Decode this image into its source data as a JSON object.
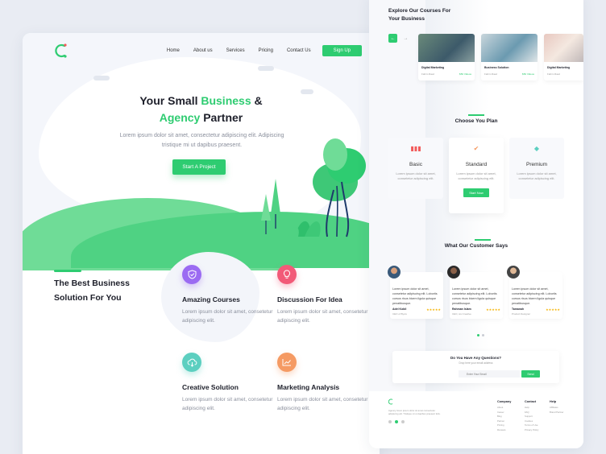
{
  "nav": {
    "items": [
      "Home",
      "About us",
      "Services",
      "Pricing",
      "Contact Us"
    ],
    "signup_label": "Sign Up"
  },
  "hero": {
    "title_1": "Your Small ",
    "title_green_1": "Business",
    "title_2": " &",
    "title_green_2": "Agency",
    "title_3": " Partner",
    "subtitle": "Lorem ipsum dolor sit amet, consectetur adipiscing elit. Adipiscing tristique mi ut dapibus praesent.",
    "cta_label": "Start A Project"
  },
  "best": {
    "title": "The Best Business Solution For You"
  },
  "features": [
    {
      "title": "Amazing Courses",
      "desc": "Lorem ipsum dolor sit amet, consetetur adipiscing elit.",
      "icon": "shield-check-icon",
      "color": "#9b6bf2"
    },
    {
      "title": "Discussion For Idea",
      "desc": "Lorem ipsum dolor sit amet, consetetur adipiscing elit.",
      "icon": "lightbulb-icon",
      "color": "#f25a78"
    },
    {
      "title": "Creative Solution",
      "desc": "Lorem ipsum dolor sit amet, consetetur adipiscing elit.",
      "icon": "cloud-icon",
      "color": "#5ccfc0"
    },
    {
      "title": "Marketing Analysis",
      "desc": "Lorem ipsum dolor sit amet, consetetur adipiscing elit.",
      "icon": "chart-icon",
      "color": "#f59a63"
    }
  ],
  "explore": {
    "title": "Explore Our Courses For Your Business",
    "courses": [
      {
        "name": "Digital Marketing",
        "author": "Fahim Raaz",
        "price": "$50 Videos"
      },
      {
        "name": "Business Solution",
        "author": "Fahim Raaz",
        "price": "$50 Videos"
      },
      {
        "name": "Digital Marketing",
        "author": "Fahim Raaz",
        "price": ""
      }
    ]
  },
  "plans": {
    "title": "Choose You Plan",
    "items": [
      {
        "name": "Basic",
        "desc": "Lorem ipsum dolor sit amet, consetetur adipiscing elit.",
        "icon": "bar-chart-icon",
        "color": "#f25a5a"
      },
      {
        "name": "Standard",
        "desc": "Lorem ipsum dolor sit amet, consetetur adipiscing elit.",
        "icon": "check-circle-icon",
        "color": "#f59a63",
        "button": "Start Now"
      },
      {
        "name": "Premium",
        "desc": "Lorem ipsum dolor sit amet, consetetur adipiscing elit.",
        "icon": "diamond-icon",
        "color": "#5ccfc0"
      }
    ]
  },
  "testimonials": {
    "title": "What Our Customer Says",
    "items": [
      {
        "quote": "Lorem ipsum dolor sit amet, consetetur adipiscing elit. Lobortis cursus risus bicem ligula quisque penatibusque.",
        "name": "Adel Kobil",
        "role": "CEO of Byxis",
        "stars": "★★★★★"
      },
      {
        "quote": "Lorem ipsum dolor sit amet, consetetur adipiscing elit. Lobortis cursus risus bicem ligula quisque penatibusque.",
        "name": "Rahman Islam",
        "role": "CEO, sis Creative",
        "stars": "★★★★★"
      },
      {
        "quote": "Lorem ipsum dolor sit amet, consetetur adipiscing elit. Lobortis cursus risus bicem ligula quisque penatibusque.",
        "name": "Tamanah",
        "role": "Product Designer",
        "stars": "★★★★★"
      }
    ]
  },
  "question": {
    "title": "Do You Have Any Questions?",
    "sub": "Drop here your email address",
    "placeholder": "Enter Your Email",
    "button": "Send"
  },
  "footer": {
    "about": "Agency lorem ipsum dolor sit amet consectetur adipiscing elit. Tristique mi ut dapibus praesent felis.",
    "cols": [
      {
        "head": "Company",
        "items": [
          "About",
          "Career",
          "Blog",
          "Partner",
          "Pricing",
          "Reviews"
        ]
      },
      {
        "head": "Contact",
        "items": [
          "Help",
          "FAQ",
          "Support",
          "Cookies",
          "Terms of Use",
          "Privacy Policy"
        ]
      },
      {
        "head": "Help",
        "items": [
          "Affiliates",
          "Brand Partner"
        ]
      }
    ]
  },
  "colors": {
    "accent": "#2ecc71"
  }
}
